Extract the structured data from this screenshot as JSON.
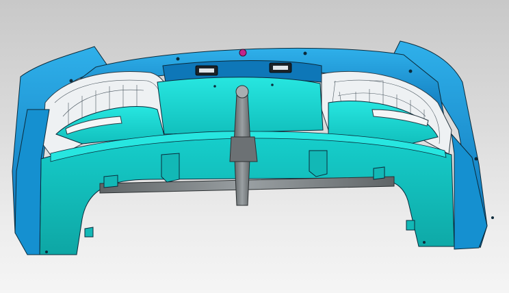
{
  "viewport": {
    "background_top": "#c8c8c8",
    "background_bottom": "#f5f5f5"
  },
  "model": {
    "part": "rear-bumper",
    "colors": {
      "shell_blue": "#1a9bd8",
      "shell_blue_dark": "#0c6fb0",
      "panel_cyan": "#14d3d0",
      "panel_cyan_light": "#27e6e0",
      "panel_cyan_dark": "#0fa9a8",
      "cavity_white": "#eef1f3",
      "bracket_gray": "#7b8083",
      "edge_dark": "#0b2a3a",
      "marker_magenta": "#c0268c"
    },
    "icons": [
      "license-light-left-icon",
      "license-light-right-icon",
      "tow-hitch-icon"
    ]
  }
}
